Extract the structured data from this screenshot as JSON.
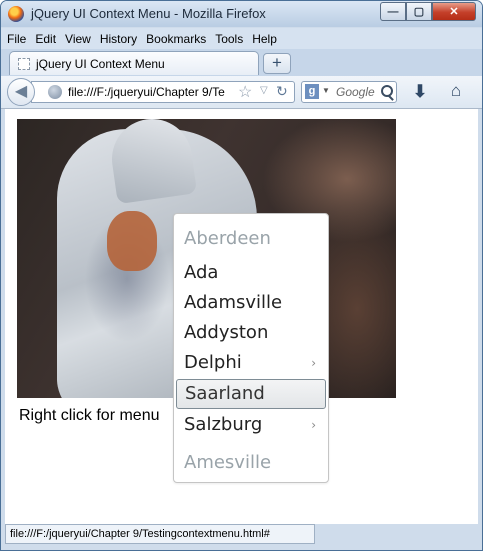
{
  "window": {
    "title": "jQuery UI Context Menu - Mozilla Firefox"
  },
  "menubar": {
    "items": [
      "File",
      "Edit",
      "View",
      "History",
      "Bookmarks",
      "Tools",
      "Help"
    ]
  },
  "tabs": [
    {
      "label": "jQuery UI Context Menu"
    }
  ],
  "navbar": {
    "url": "file:///F:/jqueryui/Chapter 9/Te",
    "search_placeholder": "Google"
  },
  "page": {
    "hint_text": "Right click for menu"
  },
  "context_menu": {
    "items": [
      {
        "label": "Aberdeen",
        "state": "disabled",
        "has_submenu": false
      },
      {
        "label": "Ada",
        "state": "normal",
        "has_submenu": false
      },
      {
        "label": "Adamsville",
        "state": "normal",
        "has_submenu": false
      },
      {
        "label": "Addyston",
        "state": "normal",
        "has_submenu": false
      },
      {
        "label": "Delphi",
        "state": "normal",
        "has_submenu": true
      },
      {
        "label": "Saarland",
        "state": "active",
        "has_submenu": false
      },
      {
        "label": "Salzburg",
        "state": "normal",
        "has_submenu": true
      },
      {
        "label": "Amesville",
        "state": "disabled",
        "has_submenu": false
      }
    ]
  },
  "statusbar": {
    "text": "file:///F:/jqueryui/Chapter 9/Testingcontextmenu.html#"
  },
  "colors": {
    "chrome_blue": "#cfdceb",
    "close_red": "#c4402a",
    "menu_disabled": "#99a3a9",
    "menu_active_border": "#7e8c95"
  }
}
